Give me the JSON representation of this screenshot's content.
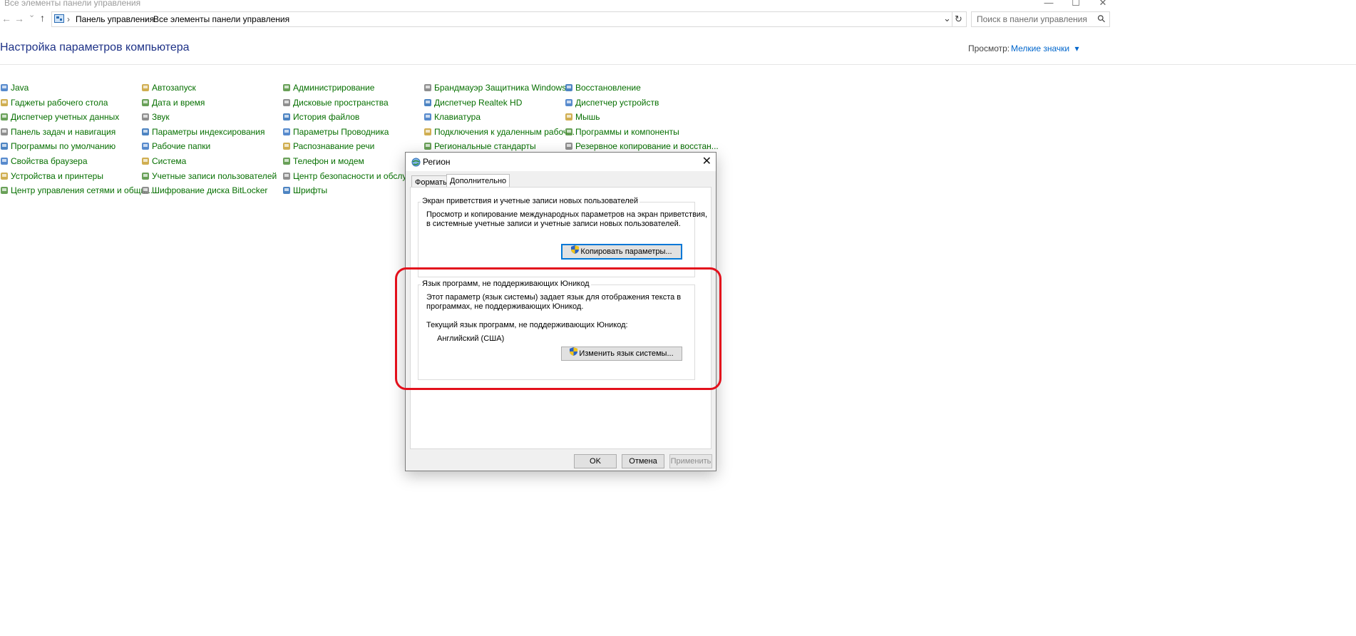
{
  "window": {
    "title": "Все элементы панели управления",
    "minimize_glyph": "—",
    "maximize_glyph": "☐",
    "close_glyph": "✕"
  },
  "nav": {
    "back_glyph": "←",
    "forward_glyph": "→",
    "recent_glyph": "⌄",
    "up_glyph": "↑",
    "breadcrumb": [
      "Панель управления",
      "Все элементы панели управления"
    ],
    "separator": "›",
    "dropdown_glyph": "⌄",
    "refresh_glyph": "↻",
    "search_placeholder": "Поиск в панели управления",
    "search_glyph": "⚲"
  },
  "header": {
    "title": "Настройка параметров компьютера",
    "view_label": "Просмотр:",
    "view_value": "Мелкие значки",
    "view_arrow": "▾"
  },
  "columns": [
    [
      "Java",
      "Гаджеты рабочего стола",
      "Диспетчер учетных данных",
      "Панель задач и навигация",
      "Программы по умолчанию",
      "Свойства браузера",
      "Устройства и принтеры",
      "Центр управления сетями и общи..."
    ],
    [
      "Автозапуск",
      "Дата и время",
      "Звук",
      "Параметры индексирования",
      "Рабочие папки",
      "Система",
      "Учетные записи пользователей",
      "Шифрование диска BitLocker"
    ],
    [
      "Администрирование",
      "Дисковые пространства",
      "История файлов",
      "Параметры Проводника",
      "Распознавание речи",
      "Телефон и модем",
      "Центр безопасности и обслужива",
      "Шрифты"
    ],
    [
      "Брандмауэр Защитника Windows",
      "Диспетчер Realtek HD",
      "Клавиатура",
      "Подключения к удаленным рабоч...",
      "Региональные стандарты"
    ],
    [
      "Восстановление",
      "Диспетчер устройств",
      "Мышь",
      "Программы и компоненты",
      "Резервное копирование и восстан..."
    ]
  ],
  "icon_colors": [
    "#3a76c4",
    "#c8a033",
    "#4f8f3b",
    "#7b7b7b",
    "#2e6fb7"
  ],
  "dialog": {
    "title": "Регион",
    "close_glyph": "✕",
    "tabs": [
      "Форматы",
      "Дополнительно"
    ],
    "welcome": {
      "legend": "Экран приветствия и учетные записи новых пользователей",
      "line1": "Просмотр и копирование международных параметров на экран приветствия,",
      "line2": "в системные учетные записи и учетные записи новых пользователей.",
      "button": "Копировать параметры..."
    },
    "nonunicode": {
      "legend": "Язык программ, не поддерживающих Юникод",
      "line1": "Этот параметр (язык системы) задает язык для отображения текста в",
      "line2": "программах, не поддерживающих Юникод.",
      "current_label": "Текущий язык программ, не поддерживающих Юникод:",
      "current_value": "Английский (США)",
      "button": "Изменить язык системы..."
    },
    "buttons": {
      "ok": "OK",
      "cancel": "Отмена",
      "apply": "Применить"
    }
  },
  "annotation_color": "#e3101c"
}
